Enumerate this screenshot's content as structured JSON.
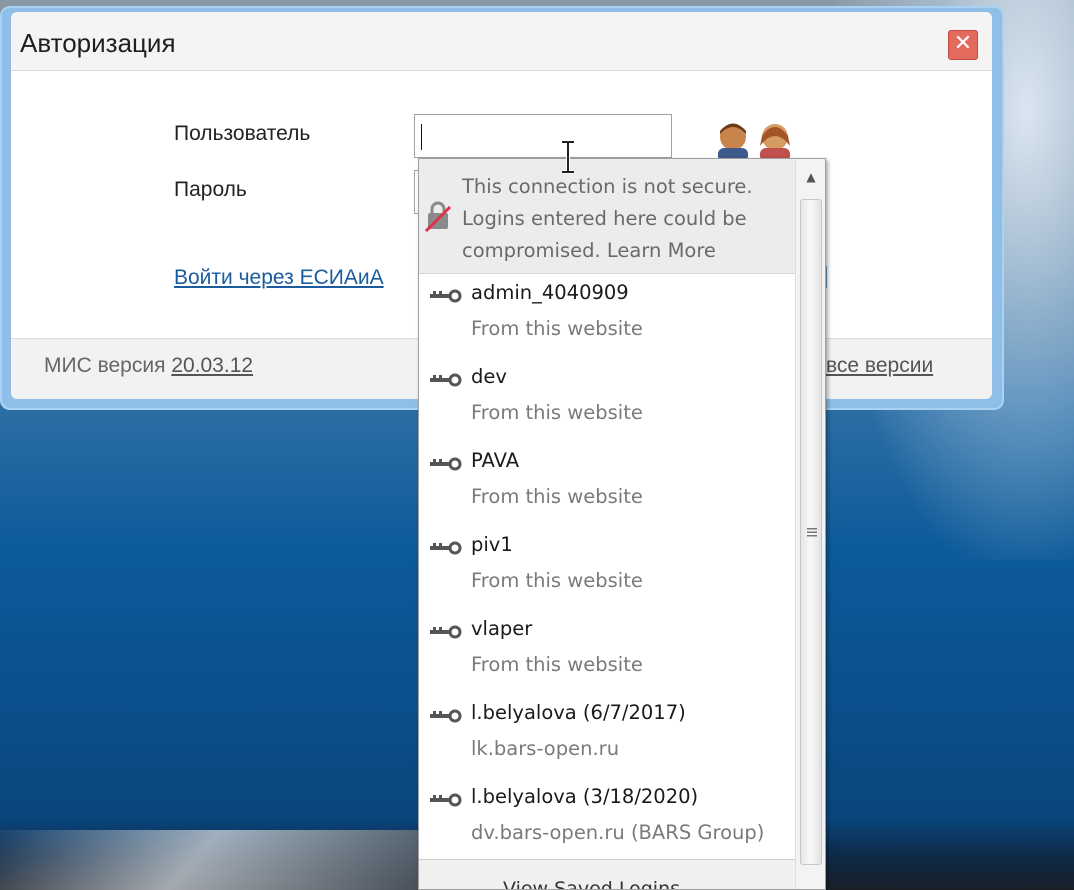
{
  "dialog": {
    "title": "Авторизация",
    "close_label": "✕",
    "user_label": "Пользователь",
    "password_label": "Пароль",
    "username_value": "",
    "esia_link": "Войти через ЕСИАиА",
    "right_mark": "|",
    "version_label": "МИС версия ",
    "version_value": "20.03.12",
    "all_versions": "все версии"
  },
  "autocomplete": {
    "warning": "This connection is not secure. Logins entered here could be compromised. Learn More",
    "entries": [
      {
        "username": "admin_4040909",
        "source": "From this website"
      },
      {
        "username": "dev",
        "source": "From this website"
      },
      {
        "username": "PAVA",
        "source": "From this website"
      },
      {
        "username": "piv1",
        "source": "From this website"
      },
      {
        "username": "vlaper",
        "source": "From this website"
      },
      {
        "username": "l.belyalova (6/7/2017)",
        "source": "lk.bars-open.ru"
      },
      {
        "username": "l.belyalova (3/18/2020)",
        "source": "dv.bars-open.ru (BARS Group)"
      }
    ],
    "footer": "View Saved Logins"
  },
  "colors": {
    "link": "#1a5c9e",
    "close_button": "#e26b5e",
    "dialog_frame": "#8fbfe6",
    "warning_bg": "#ececec"
  }
}
